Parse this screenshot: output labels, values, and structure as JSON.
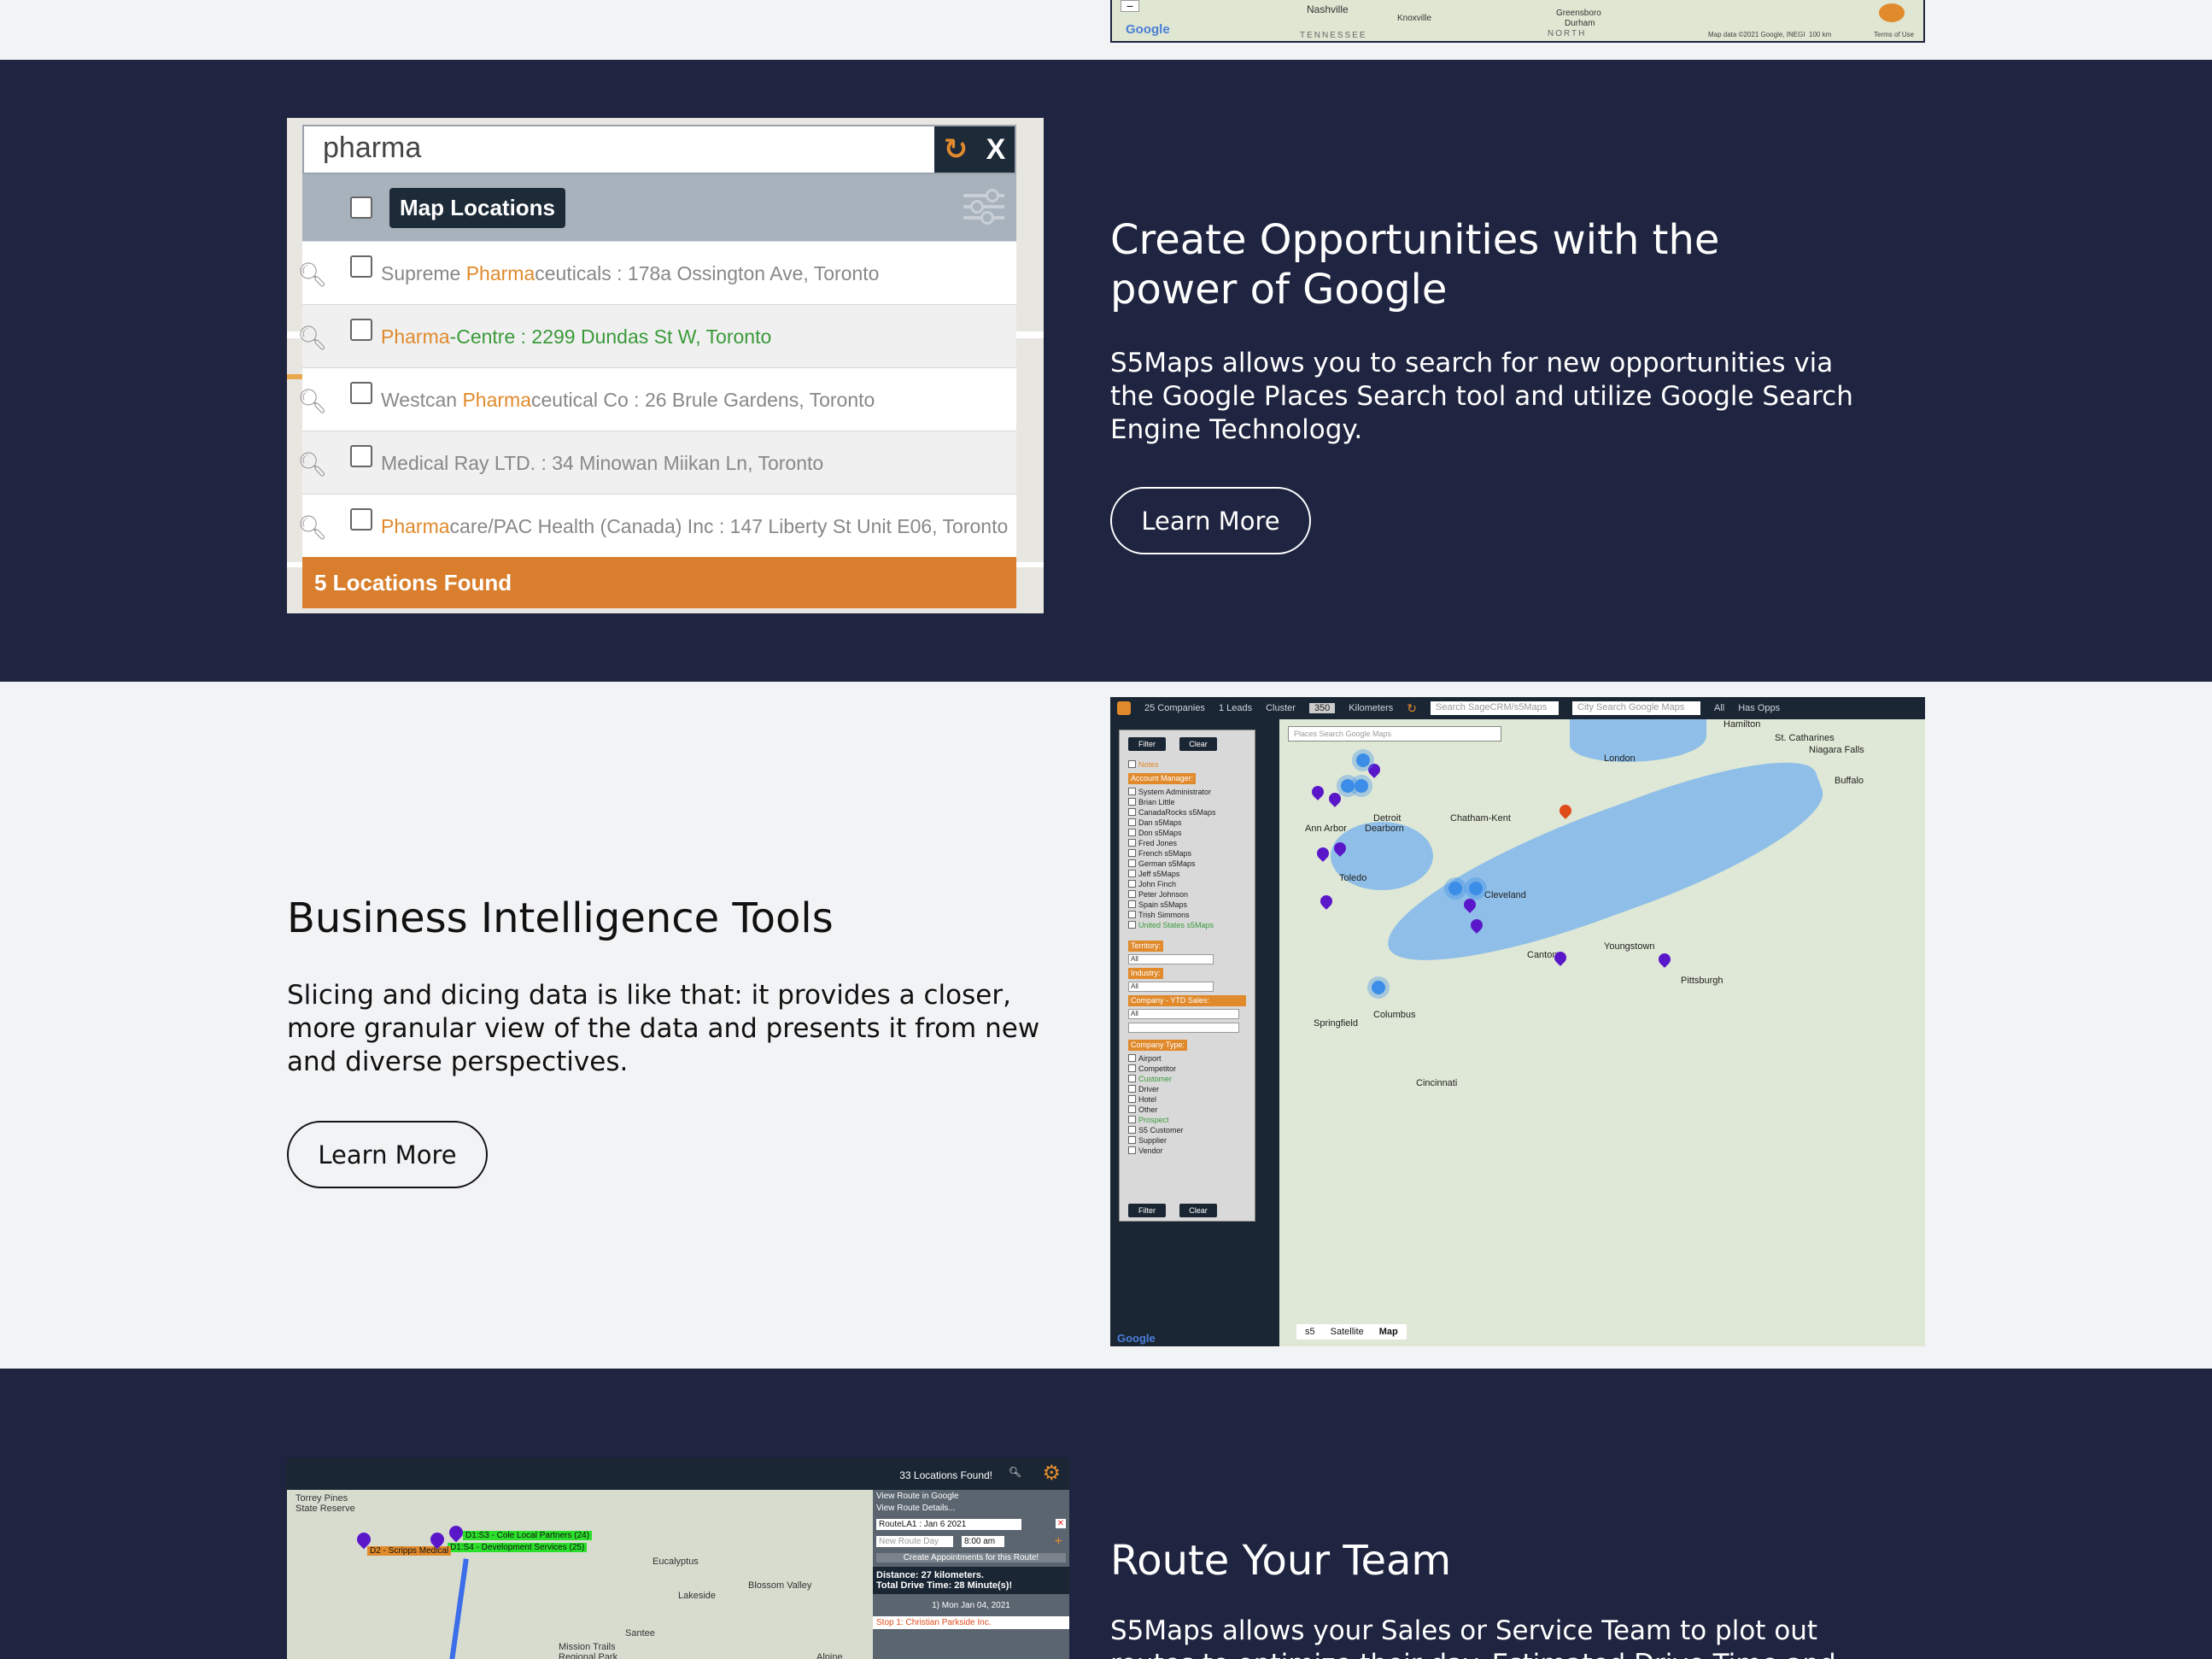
{
  "sections": {
    "google": {
      "title_line1": "Create Opportunities with the",
      "title_line2": "power of Google",
      "body_line1": "S5Maps allows you to search for new opportunities via",
      "body_line2": "the Google Places Search tool and utilize Google Search",
      "body_line3": "Engine Technology.",
      "button": "Learn More"
    },
    "bi": {
      "title": "Business Intelligence Tools",
      "body_line1": "Slicing and dicing data is like that: it provides a closer,",
      "body_line2": "more granular view of the data and presents it from new",
      "body_line3": "and diverse perspectives.",
      "button": "Learn More"
    },
    "route": {
      "title": "Route Your Team",
      "body_line1": "S5Maps allows your Sales or Service Team to plot out",
      "body_line2": "routes to optimize their day. Estimated Drive Time and"
    }
  },
  "top_map": {
    "labels": [
      "Nashville",
      "Knoxville",
      "Greensboro",
      "Durham",
      "NORTH",
      "TENNESSEE"
    ],
    "google": "Google",
    "footer": "Map data ©2021 Google, INEGI",
    "scale": "100 km",
    "terms": "Terms of Use"
  },
  "places_screenshot": {
    "query": "pharma",
    "refresh_icon": "refresh-icon",
    "close": "X",
    "header_tag": "Map Locations",
    "results": [
      {
        "pre": "Supreme ",
        "hl": "Pharma",
        "rest": "ceuticals : 178a Ossington Ave, Toronto",
        "green": false
      },
      {
        "pre": "",
        "hl": "Pharma",
        "rest": "-Centre : 2299 Dundas St W, Toronto",
        "green": true
      },
      {
        "pre": "Westcan ",
        "hl": "Pharma",
        "rest": "ceutical Co : 26 Brule Gardens, Toronto",
        "green": false
      },
      {
        "pre": "Medical Ray LTD. : 34 Minowan Miikan Ln, Toronto",
        "hl": "",
        "rest": "",
        "green": false
      },
      {
        "pre": "",
        "hl": "Pharma",
        "rest": "care/PAC Health (Canada) Inc : 147 Liberty St Unit E06, Toronto",
        "green": false
      }
    ],
    "footer": "5 Locations Found"
  },
  "bi_screenshot": {
    "topbar": [
      "25 Companies",
      "1 Leads",
      "Cluster",
      "Kilometers"
    ],
    "distance": "350",
    "search1": "Search SageCRM/s5Maps",
    "search2": "City Search Google Maps",
    "all": "All",
    "has_opps": "Has Opps",
    "places": "Places Search Google Maps",
    "filter": "Filter",
    "clear": "Clear",
    "notes": "Notes",
    "account_manager": "Account Manager:",
    "managers": [
      "System Administrator",
      "Brian Little",
      "CanadaRocks s5Maps",
      "Dan s5Maps",
      "Don s5Maps",
      "Fred Jones",
      "French s5Maps",
      "German s5Maps",
      "Jeff s5Maps",
      "John Finch",
      "Peter Johnson",
      "Spain s5Maps",
      "Trish Simmons",
      "United States s5Maps"
    ],
    "territory": "Territory:",
    "industry": "Industry:",
    "ytd": "Company - YTD Sales:",
    "company_type": "Company Type:",
    "types": [
      "Airport",
      "Competitor",
      "Customer",
      "Driver",
      "Hotel",
      "Other",
      "Prospect",
      "S5 Customer",
      "Supplier",
      "Vendor"
    ],
    "all_option": "All",
    "cities": [
      "Hamilton",
      "St. Catharines",
      "Niagara Falls",
      "Buffalo",
      "London",
      "Chatham-Kent",
      "Detroit",
      "Dearborn",
      "Ann Arbor",
      "Toledo",
      "Cleveland",
      "Youngstown",
      "Canton",
      "Pittsburgh",
      "Columbus",
      "Springfield",
      "Cincinnati"
    ],
    "map_buttons": [
      "s5",
      "Satellite",
      "Map"
    ],
    "google": "Google"
  },
  "route_screenshot": {
    "found": "33 Locations Found!",
    "links": [
      "View Route in Google",
      "View Route Details..."
    ],
    "route_select": "RouteLA1 : Jan 6 2021",
    "new_route": "New Route Day",
    "time": "8:00 am",
    "create": "Create Appointments for this Route!",
    "distance": "Distance: 27 kilometers.",
    "drive": "Total Drive Time: 28 Minute(s)!",
    "day": "1) Mon Jan 04, 2021",
    "stop": "Stop 1: Christian Parkside Inc.",
    "labels": [
      "D1:S3 - Cole Local Partners (24)",
      "D1:S4 - Development Services (25)",
      "D2 - Scripps Medical"
    ],
    "places": [
      "Torrey Pines State Reserve",
      "Eucalyptus",
      "Lakeside",
      "Santee",
      "Mission Trails Regional Park",
      "Blossom Valley",
      "Alpine"
    ]
  }
}
